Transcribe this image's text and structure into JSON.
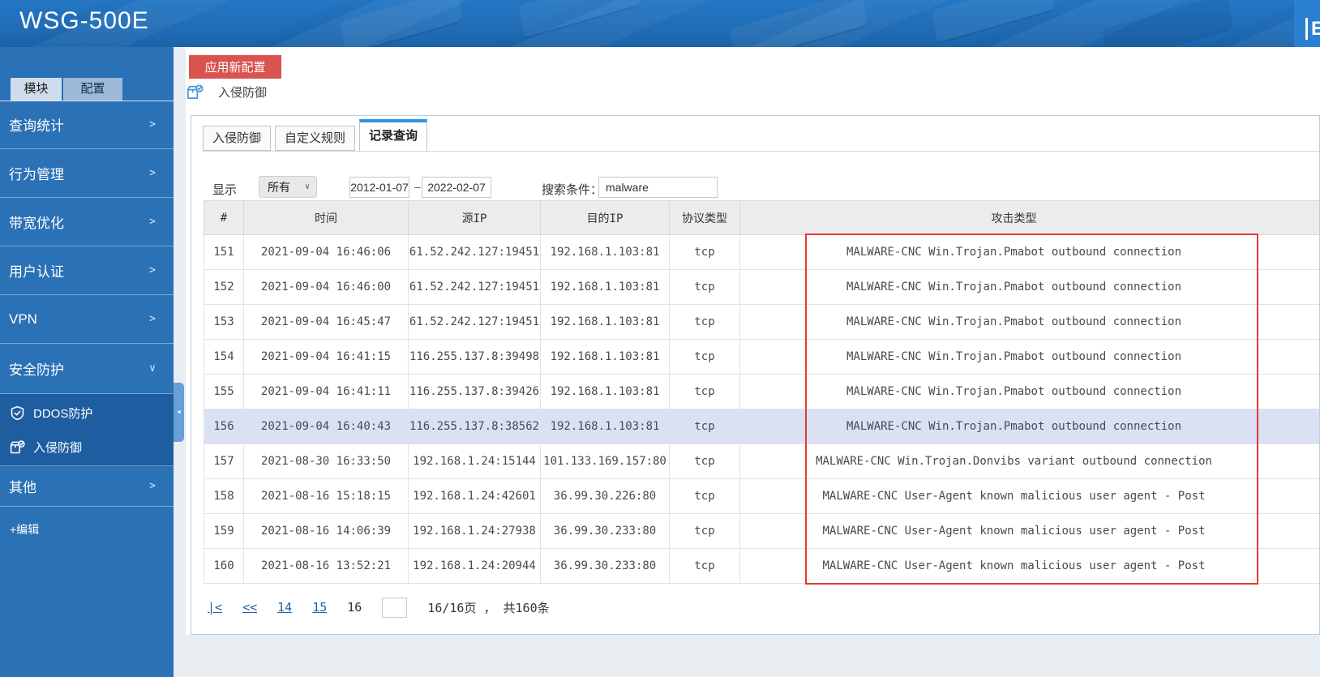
{
  "header": {
    "title": "WSG-500E",
    "corner_label": "E"
  },
  "sidebar": {
    "tabs": {
      "module": "模块",
      "config": "配置"
    },
    "items": [
      {
        "label": "查询统计",
        "chevron": ">"
      },
      {
        "label": "行为管理",
        "chevron": ">"
      },
      {
        "label": "带宽优化",
        "chevron": ">"
      },
      {
        "label": "用户认证",
        "chevron": ">"
      },
      {
        "label": "VPN",
        "chevron": ">"
      }
    ],
    "security": {
      "label": "安全防护",
      "chevron": "∨"
    },
    "submenu": {
      "ddos": "DDOS防护",
      "ips": "入侵防御"
    },
    "other": {
      "label": "其他",
      "chevron": ">"
    },
    "edit_link": "+编辑",
    "collapse_arrow": "◄"
  },
  "toolbar": {
    "apply_button": "应用新配置",
    "breadcrumb": "入侵防御"
  },
  "content_tabs": [
    {
      "label": "入侵防御"
    },
    {
      "label": "自定义规则"
    },
    {
      "label": "记录查询",
      "active": true
    }
  ],
  "filters": {
    "show_label": "显示",
    "show_value": "所有",
    "select_chevron": "∨",
    "date_from": "2012-01-07",
    "dash": "–",
    "date_to": "2022-02-07",
    "search_label": "搜索条件：",
    "search_value": "malware"
  },
  "table": {
    "columns": [
      "#",
      "时间",
      "源IP",
      "目的IP",
      "协议类型",
      "攻击类型"
    ],
    "highlighted_row": "156",
    "rows": [
      [
        "151",
        "2021-09-04 16:46:06",
        "61.52.242.127:19451",
        "192.168.1.103:81",
        "tcp",
        "MALWARE-CNC Win.Trojan.Pmabot outbound connection"
      ],
      [
        "152",
        "2021-09-04 16:46:00",
        "61.52.242.127:19451",
        "192.168.1.103:81",
        "tcp",
        "MALWARE-CNC Win.Trojan.Pmabot outbound connection"
      ],
      [
        "153",
        "2021-09-04 16:45:47",
        "61.52.242.127:19451",
        "192.168.1.103:81",
        "tcp",
        "MALWARE-CNC Win.Trojan.Pmabot outbound connection"
      ],
      [
        "154",
        "2021-09-04 16:41:15",
        "116.255.137.8:39498",
        "192.168.1.103:81",
        "tcp",
        "MALWARE-CNC Win.Trojan.Pmabot outbound connection"
      ],
      [
        "155",
        "2021-09-04 16:41:11",
        "116.255.137.8:39426",
        "192.168.1.103:81",
        "tcp",
        "MALWARE-CNC Win.Trojan.Pmabot outbound connection"
      ],
      [
        "156",
        "2021-09-04 16:40:43",
        "116.255.137.8:38562",
        "192.168.1.103:81",
        "tcp",
        "MALWARE-CNC Win.Trojan.Pmabot outbound connection"
      ],
      [
        "157",
        "2021-08-30 16:33:50",
        "192.168.1.24:15144",
        "101.133.169.157:80",
        "tcp",
        "MALWARE-CNC Win.Trojan.Donvibs variant outbound connection"
      ],
      [
        "158",
        "2021-08-16 15:18:15",
        "192.168.1.24:42601",
        "36.99.30.226:80",
        "tcp",
        "MALWARE-CNC User-Agent known malicious user agent - Post"
      ],
      [
        "159",
        "2021-08-16 14:06:39",
        "192.168.1.24:27938",
        "36.99.30.233:80",
        "tcp",
        "MALWARE-CNC User-Agent known malicious user agent - Post"
      ],
      [
        "160",
        "2021-08-16 13:52:21",
        "192.168.1.24:20944",
        "36.99.30.233:80",
        "tcp",
        "MALWARE-CNC User-Agent known malicious user agent - Post"
      ]
    ]
  },
  "pagination": {
    "first": "|<",
    "prev": "<<",
    "pages": [
      "14",
      "15"
    ],
    "current": "16",
    "jump_value": "",
    "summary": "16/16页 ， 共160条"
  },
  "annotation": {
    "color": "#e8392f"
  }
}
